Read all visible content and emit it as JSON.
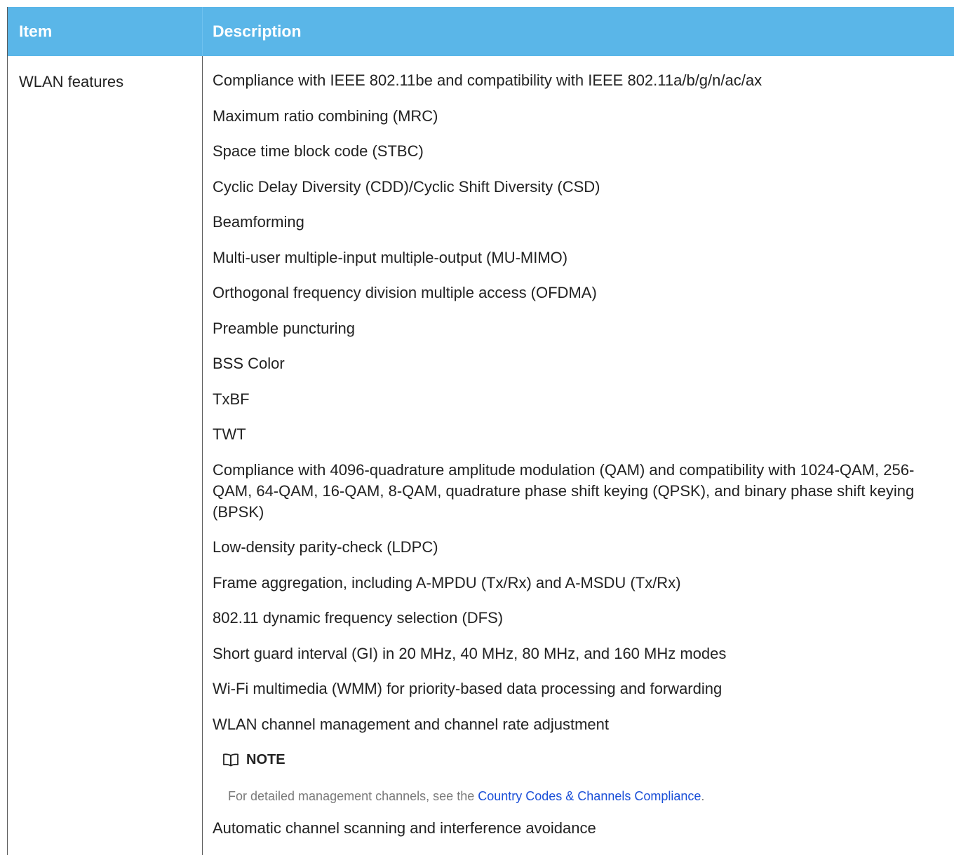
{
  "table": {
    "header": {
      "item": "Item",
      "description": "Description"
    },
    "row": {
      "item": "WLAN features",
      "descriptions": [
        "Compliance with IEEE 802.11be and compatibility with IEEE 802.11a/b/g/n/ac/ax",
        "Maximum ratio combining (MRC)",
        "Space time block code (STBC)",
        "Cyclic Delay Diversity (CDD)/Cyclic Shift Diversity (CSD)",
        "Beamforming",
        "Multi-user multiple-input multiple-output (MU-MIMO)",
        "Orthogonal frequency division multiple access (OFDMA)",
        "Preamble puncturing",
        "BSS Color",
        "TxBF",
        "TWT",
        "Compliance with 4096-quadrature amplitude modulation (QAM) and compatibility with 1024-QAM, 256-QAM, 64-QAM, 16-QAM, 8-QAM, quadrature phase shift keying (QPSK), and binary phase shift keying (BPSK)",
        "Low-density parity-check (LDPC)",
        "Frame aggregation, including A-MPDU (Tx/Rx) and A-MSDU (Tx/Rx)",
        "802.11 dynamic frequency selection (DFS)",
        "Short guard interval (GI) in 20 MHz, 40 MHz, 80 MHz, and 160 MHz modes",
        "Wi-Fi multimedia (WMM) for priority-based data processing and forwarding",
        "WLAN channel management and channel rate adjustment"
      ],
      "note": {
        "title": "NOTE",
        "icon": "book-icon",
        "text_before": "For detailed management channels, see the ",
        "link_text": "Country Codes & Channels Compliance",
        "text_after": "."
      },
      "last_description": "Automatic channel scanning and interference avoidance"
    }
  },
  "colors": {
    "header_bg": "#5ab6e8",
    "link": "#1a4fd8"
  }
}
